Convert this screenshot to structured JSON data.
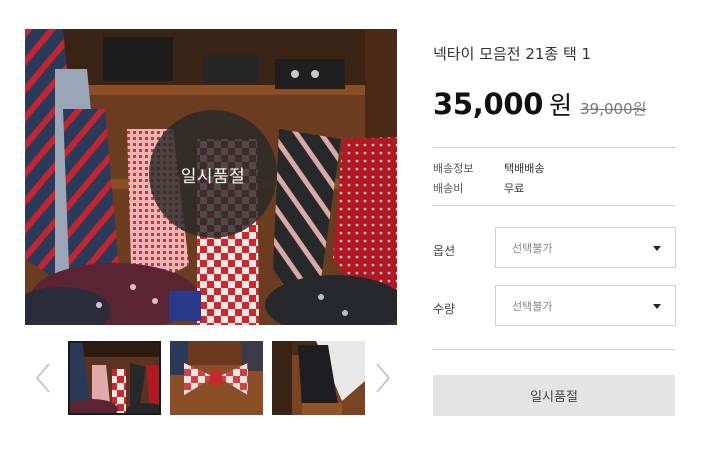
{
  "product": {
    "title": "넥타이 모음전 21종 택 1",
    "price": "35,000",
    "price_unit": "원",
    "original_price": "39,000원",
    "soldout_badge": "일시품절"
  },
  "gallery": {
    "main_image_alt": "product photo",
    "thumbnails": [
      {
        "alt": "neckties display",
        "selected": true
      },
      {
        "alt": "red bow tie",
        "selected": false
      },
      {
        "alt": "dark necktie",
        "selected": false
      }
    ]
  },
  "specs": [
    {
      "label": "배송정보",
      "value": "택배배송"
    },
    {
      "label": "배송비",
      "value": "무료"
    }
  ],
  "options": [
    {
      "label": "옵션",
      "value": "선택불가"
    },
    {
      "label": "수량",
      "value": "선택불가"
    }
  ],
  "buy_button": {
    "label": "일시품절"
  },
  "colors": {
    "accent_text": "#111111",
    "divider": "#cfcfcf",
    "button_bg": "#e4e4e4",
    "soldout_overlay": "#282828"
  }
}
